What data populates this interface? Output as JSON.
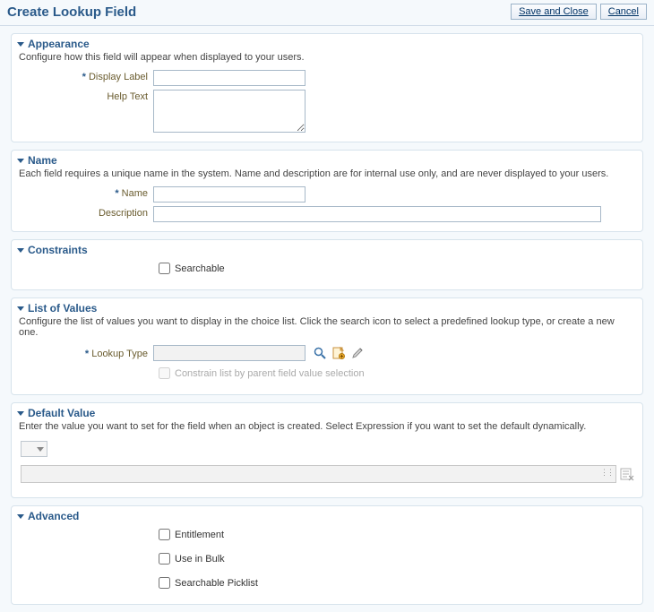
{
  "header": {
    "title": "Create Lookup Field",
    "save_and_close": "Save and Close",
    "cancel": "Cancel"
  },
  "sections": {
    "appearance": {
      "title": "Appearance",
      "desc": "Configure how this field will appear when displayed to your users.",
      "display_label": "Display Label",
      "help_text": "Help Text"
    },
    "name": {
      "title": "Name",
      "desc": "Each field requires a unique name in the system. Name and description are for internal use only, and are never displayed to your users.",
      "name_label": "Name",
      "description_label": "Description"
    },
    "constraints": {
      "title": "Constraints",
      "searchable": "Searchable"
    },
    "lov": {
      "title": "List of Values",
      "desc": "Configure the list of values you want to display in the choice list. Click the search icon to select a predefined lookup type, or create a new one.",
      "lookup_type": "Lookup Type",
      "constrain": "Constrain list by parent field value selection"
    },
    "default_value": {
      "title": "Default Value",
      "desc": "Enter the value you want to set for the field when an object is created. Select Expression if you want to set the default dynamically."
    },
    "advanced": {
      "title": "Advanced",
      "entitlement": "Entitlement",
      "use_in_bulk": "Use in Bulk",
      "searchable_picklist": "Searchable Picklist"
    }
  }
}
